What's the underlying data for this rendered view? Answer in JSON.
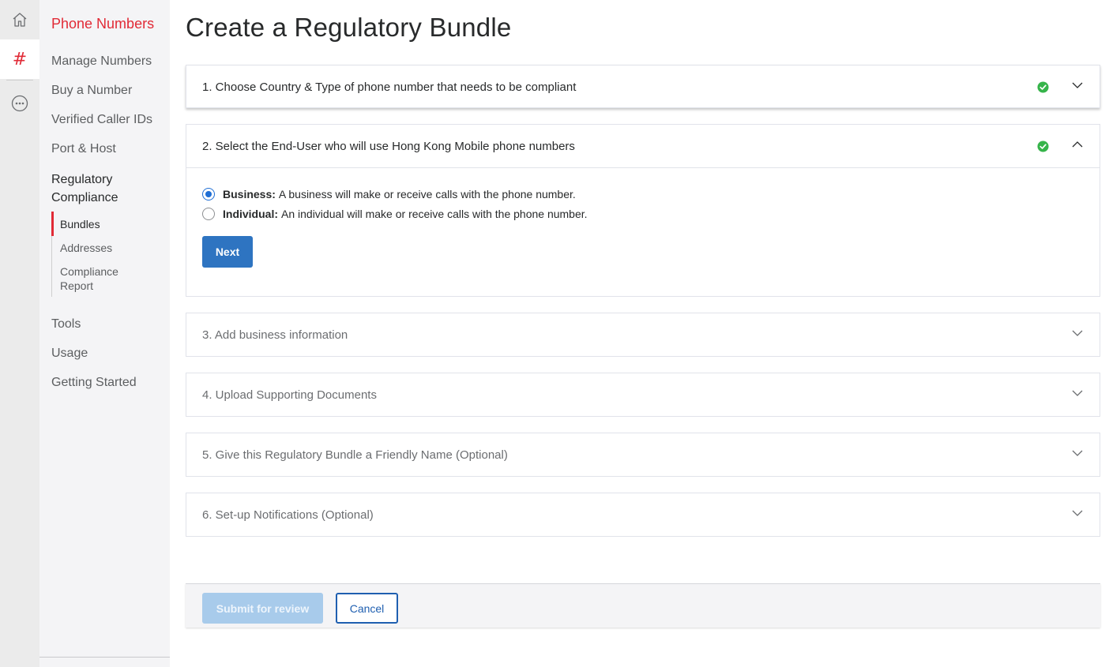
{
  "rail": {
    "items": [
      {
        "icon": "home-icon"
      },
      {
        "icon": "hash-icon",
        "glyph": "#"
      },
      {
        "icon": "more-options-icon"
      }
    ]
  },
  "subnav": {
    "title": "Phone Numbers",
    "items": [
      {
        "label": "Manage Numbers"
      },
      {
        "label": "Buy a Number"
      },
      {
        "label": "Verified Caller IDs"
      },
      {
        "label": "Port & Host"
      },
      {
        "label": "Regulatory Compliance"
      },
      {
        "label": "Tools"
      },
      {
        "label": "Usage"
      },
      {
        "label": "Getting Started"
      }
    ],
    "compliance_sub": [
      {
        "label": "Bundles"
      },
      {
        "label": "Addresses"
      },
      {
        "label": "Compliance Report"
      }
    ]
  },
  "page": {
    "title": "Create a Regulatory Bundle"
  },
  "steps": [
    {
      "title": "1. Choose Country & Type of phone number that needs to be compliant",
      "complete": true,
      "expanded": false
    },
    {
      "title": "2. Select the End-User who will use Hong Kong Mobile phone numbers",
      "complete": true,
      "expanded": true
    },
    {
      "title": "3. Add business information",
      "complete": false,
      "expanded": false
    },
    {
      "title": "4. Upload Supporting Documents",
      "complete": false,
      "expanded": false
    },
    {
      "title": "5. Give this Regulatory Bundle a Friendly Name (Optional)",
      "complete": false,
      "expanded": false
    },
    {
      "title": "6. Set-up Notifications (Optional)",
      "complete": false,
      "expanded": false
    }
  ],
  "end_user": {
    "options": [
      {
        "label": "Business:",
        "description": "A business will make or receive calls with the phone number.",
        "selected": true
      },
      {
        "label": "Individual:",
        "description": "An individual will make or receive calls with the phone number.",
        "selected": false
      }
    ],
    "next_label": "Next"
  },
  "footer": {
    "submit_label": "Submit for review",
    "cancel_label": "Cancel"
  },
  "colors": {
    "brand_red": "#e12a36",
    "primary_blue": "#2e74c1",
    "success_green": "#36b44a"
  }
}
